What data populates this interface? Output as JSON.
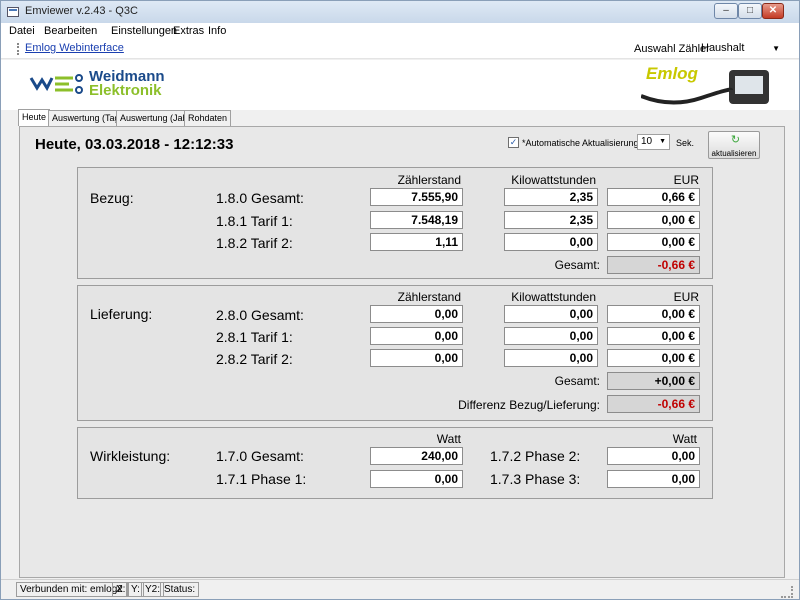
{
  "window": {
    "title": "Emviewer v.2.43 - Q3C"
  },
  "menu": [
    "Datei",
    "Bearbeiten",
    "Einstellungen",
    "Extras",
    "Info"
  ],
  "toolbar": {
    "web_link": "Emlog Webinterface",
    "meter_label": "Auswahl Zähler",
    "meter_value": "Haushalt"
  },
  "logo": {
    "line1": "Weidmann",
    "line2": "Elektronik",
    "emlog": "Emlog"
  },
  "tabs": [
    "Heute",
    "Auswertung (Tag)",
    "Auswertung (Jahr)",
    "Rohdaten"
  ],
  "page": {
    "heading": "Heute, 03.03.2018 - 12:12:33",
    "auto_refresh_label": "*Automatische Aktualisierung alle",
    "interval": "10",
    "unit_seconds": "Sek.",
    "refresh_button": "aktualisieren"
  },
  "columns": {
    "meter": "Zählerstand",
    "kwh": "Kilowattstunden",
    "eur": "EUR",
    "watt": "Watt"
  },
  "bezug": {
    "label": "Bezug:",
    "rows": [
      {
        "label": "1.8.0 Gesamt:",
        "meter": "7.555,90",
        "kwh": "2,35",
        "eur": "0,66 €"
      },
      {
        "label": "1.8.1 Tarif 1:",
        "meter": "7.548,19",
        "kwh": "2,35",
        "eur": "0,00 €"
      },
      {
        "label": "1.8.2 Tarif 2:",
        "meter": "1,11",
        "kwh": "0,00",
        "eur": "0,00 €"
      }
    ],
    "total_label": "Gesamt:",
    "total": "-0,66 €"
  },
  "lieferung": {
    "label": "Lieferung:",
    "rows": [
      {
        "label": "2.8.0 Gesamt:",
        "meter": "0,00",
        "kwh": "0,00",
        "eur": "0,00 €"
      },
      {
        "label": "2.8.1 Tarif 1:",
        "meter": "0,00",
        "kwh": "0,00",
        "eur": "0,00 €"
      },
      {
        "label": "2.8.2 Tarif 2:",
        "meter": "0,00",
        "kwh": "0,00",
        "eur": "0,00 €"
      }
    ],
    "total_label": "Gesamt:",
    "total": "+0,00 €",
    "diff_label": "Differenz Bezug/Lieferung:",
    "diff": "-0,66 €"
  },
  "wirkleistung": {
    "label": "Wirkleistung:",
    "left": [
      {
        "label": "1.7.0 Gesamt:",
        "value": "240,00"
      },
      {
        "label": "1.7.1 Phase 1:",
        "value": "0,00"
      }
    ],
    "right": [
      {
        "label": "1.7.2 Phase 2:",
        "value": "0,00"
      },
      {
        "label": "1.7.3 Phase 3:",
        "value": "0,00"
      }
    ]
  },
  "status": {
    "connected": "Verbunden mit: emlog2",
    "x": "X:",
    "y": "Y:",
    "y2": "Y2:",
    "status": "Status:"
  },
  "colors": {
    "negative": "#c00000",
    "link": "#1a3fb0",
    "accent": "#8cbf2a"
  }
}
